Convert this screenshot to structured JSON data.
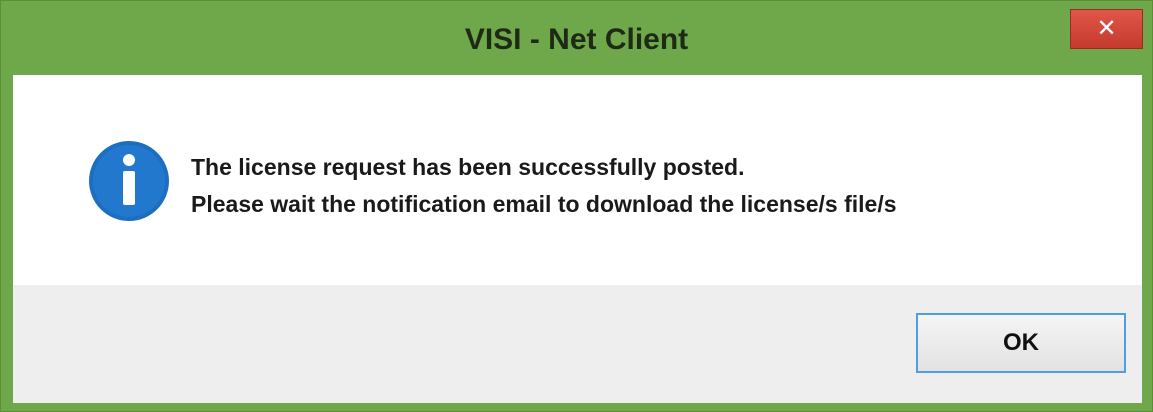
{
  "window": {
    "title": "VISI - Net Client",
    "close_glyph": "✕",
    "frame_color": "#6fa84a",
    "close_color": "#d24a3d"
  },
  "message": {
    "icon": "info-icon",
    "icon_color": "#1c6fc0",
    "line1": "The license request has been successfully posted.",
    "line2": "Please wait the notification email to download the license/s file/s"
  },
  "footer": {
    "ok_label": "OK",
    "ok_border_color": "#4f9fe0"
  }
}
